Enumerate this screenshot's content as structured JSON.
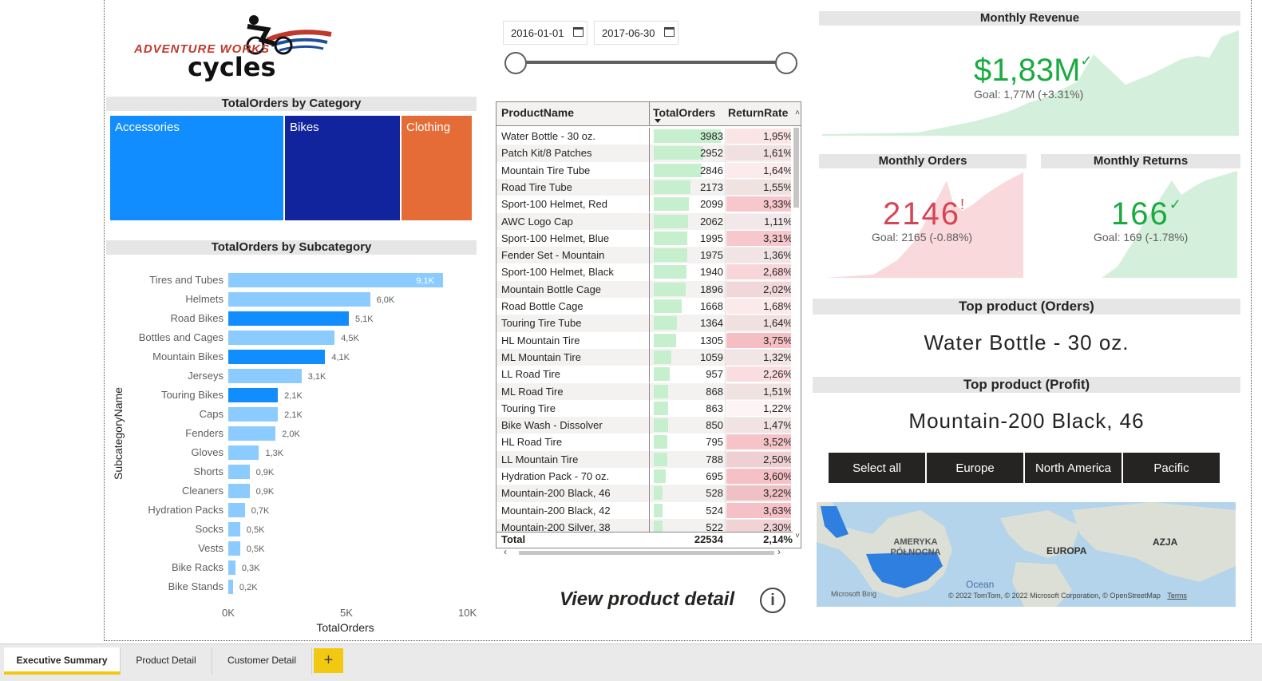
{
  "logo": {
    "line1": "ADVENTURE WORKS",
    "line2": "cycles"
  },
  "date_range": {
    "start": "2016-01-01",
    "end": "2017-06-30"
  },
  "treemap": {
    "title": "TotalOrders by Category",
    "items": [
      {
        "label": "Accessories",
        "color": "#118dff"
      },
      {
        "label": "Bikes",
        "color": "#12239e"
      },
      {
        "label": "Clothing",
        "color": "#e66c37"
      }
    ]
  },
  "chart_data": {
    "type": "bar",
    "title": "TotalOrders by Subcategory",
    "xlabel": "TotalOrders",
    "ylabel": "SubcategoryName",
    "xlim": [
      0,
      10000
    ],
    "xticks": [
      "0K",
      "5K",
      "10K"
    ],
    "categories": [
      "Tires and Tubes",
      "Helmets",
      "Road Bikes",
      "Bottles and Cages",
      "Mountain Bikes",
      "Jerseys",
      "Touring Bikes",
      "Caps",
      "Fenders",
      "Gloves",
      "Shorts",
      "Cleaners",
      "Hydration Packs",
      "Socks",
      "Vests",
      "Bike Racks",
      "Bike Stands"
    ],
    "values": [
      9100,
      6000,
      5100,
      4500,
      4100,
      3100,
      2100,
      2100,
      2000,
      1300,
      900,
      900,
      700,
      500,
      500,
      300,
      200
    ],
    "data_labels": [
      "9,1K",
      "6,0K",
      "5,1K",
      "4,5K",
      "4,1K",
      "3,1K",
      "2,1K",
      "2,1K",
      "2,0K",
      "1,3K",
      "0,9K",
      "0,9K",
      "0,7K",
      "0,5K",
      "0,5K",
      "0,3K",
      "0,2K"
    ],
    "highlight": [
      false,
      false,
      true,
      false,
      true,
      false,
      true,
      false,
      false,
      false,
      false,
      false,
      false,
      false,
      false,
      false,
      false
    ],
    "colors": {
      "normal": "#8ccbff",
      "highlight": "#118dff"
    }
  },
  "table": {
    "headers": [
      "ProductName",
      "TotalOrders",
      "ReturnRate"
    ],
    "rows": [
      {
        "name": "Water Bottle - 30 oz.",
        "orders": "3983",
        "rate": "1,95%",
        "o": 3983,
        "r": 1.95
      },
      {
        "name": "Patch Kit/8 Patches",
        "orders": "2952",
        "rate": "1,61%",
        "o": 2952,
        "r": 1.61
      },
      {
        "name": "Mountain Tire Tube",
        "orders": "2846",
        "rate": "1,64%",
        "o": 2846,
        "r": 1.64
      },
      {
        "name": "Road Tire Tube",
        "orders": "2173",
        "rate": "1,55%",
        "o": 2173,
        "r": 1.55
      },
      {
        "name": "Sport-100 Helmet, Red",
        "orders": "2099",
        "rate": "3,33%",
        "o": 2099,
        "r": 3.33
      },
      {
        "name": "AWC Logo Cap",
        "orders": "2062",
        "rate": "1,11%",
        "o": 2062,
        "r": 1.11
      },
      {
        "name": "Sport-100 Helmet, Blue",
        "orders": "1995",
        "rate": "3,31%",
        "o": 1995,
        "r": 3.31
      },
      {
        "name": "Fender Set - Mountain",
        "orders": "1975",
        "rate": "1,36%",
        "o": 1975,
        "r": 1.36
      },
      {
        "name": "Sport-100 Helmet, Black",
        "orders": "1940",
        "rate": "2,68%",
        "o": 1940,
        "r": 2.68
      },
      {
        "name": "Mountain Bottle Cage",
        "orders": "1896",
        "rate": "2,02%",
        "o": 1896,
        "r": 2.02
      },
      {
        "name": "Road Bottle Cage",
        "orders": "1668",
        "rate": "1,68%",
        "o": 1668,
        "r": 1.68
      },
      {
        "name": "Touring Tire Tube",
        "orders": "1364",
        "rate": "1,64%",
        "o": 1364,
        "r": 1.64
      },
      {
        "name": "HL Mountain Tire",
        "orders": "1305",
        "rate": "3,75%",
        "o": 1305,
        "r": 3.75
      },
      {
        "name": "ML Mountain Tire",
        "orders": "1059",
        "rate": "1,32%",
        "o": 1059,
        "r": 1.32
      },
      {
        "name": "LL Road Tire",
        "orders": "957",
        "rate": "2,26%",
        "o": 957,
        "r": 2.26
      },
      {
        "name": "ML Road Tire",
        "orders": "868",
        "rate": "1,51%",
        "o": 868,
        "r": 1.51
      },
      {
        "name": "Touring Tire",
        "orders": "863",
        "rate": "1,22%",
        "o": 863,
        "r": 1.22
      },
      {
        "name": "Bike Wash - Dissolver",
        "orders": "850",
        "rate": "1,47%",
        "o": 850,
        "r": 1.47
      },
      {
        "name": "HL Road Tire",
        "orders": "795",
        "rate": "3,52%",
        "o": 795,
        "r": 3.52
      },
      {
        "name": "LL Mountain Tire",
        "orders": "788",
        "rate": "2,50%",
        "o": 788,
        "r": 2.5
      },
      {
        "name": "Hydration Pack - 70 oz.",
        "orders": "695",
        "rate": "3,60%",
        "o": 695,
        "r": 3.6
      },
      {
        "name": "Mountain-200 Black, 46",
        "orders": "528",
        "rate": "3,22%",
        "o": 528,
        "r": 3.22
      },
      {
        "name": "Mountain-200 Black, 42",
        "orders": "524",
        "rate": "3,63%",
        "o": 524,
        "r": 3.63
      },
      {
        "name": "Mountain-200 Silver, 38",
        "orders": "522",
        "rate": "2,30%",
        "o": 522,
        "r": 2.3
      }
    ],
    "total": {
      "label": "Total",
      "orders": "22534",
      "rate": "2,14%"
    },
    "colors": {
      "orders_bar": "#c6efce",
      "rate_bg": "#f8d7da"
    }
  },
  "view_detail": "View product detail",
  "kpis": {
    "revenue": {
      "title": "Monthly Revenue",
      "value": "$1,83M",
      "status": "✓",
      "goal": "Goal: 1,77M (+3.31%)",
      "color": "#1aab40",
      "fill": "#d4f0dc"
    },
    "orders": {
      "title": "Monthly Orders",
      "value": "2146",
      "status": "!",
      "goal": "Goal: 2165 (-0.88%)",
      "color": "#d64554",
      "fill": "#f9d9dc"
    },
    "returns": {
      "title": "Monthly Returns",
      "value": "166",
      "status": "✓",
      "goal": "Goal: 169 (-1.78%)",
      "color": "#1aab40",
      "fill": "#d4f0dc"
    }
  },
  "top_orders": {
    "title": "Top product (Orders)",
    "value": "Water Bottle - 30 oz."
  },
  "top_profit": {
    "title": "Top product (Profit)",
    "value": "Mountain-200 Black, 46"
  },
  "regions": [
    "Select all",
    "Europe",
    "North America",
    "Pacific"
  ],
  "map": {
    "labels": [
      "AMERYKA PÓŁNOCNA",
      "EUROPA",
      "AZJA",
      "Ocean"
    ],
    "bing": "Microsoft Bing",
    "copyright": "© 2022 TomTom, © 2022 Microsoft Corporation, © OpenStreetMap",
    "terms": "Terms"
  },
  "tabs": [
    "Executive Summary",
    "Product Detail",
    "Customer Detail"
  ],
  "add_tab": "+"
}
